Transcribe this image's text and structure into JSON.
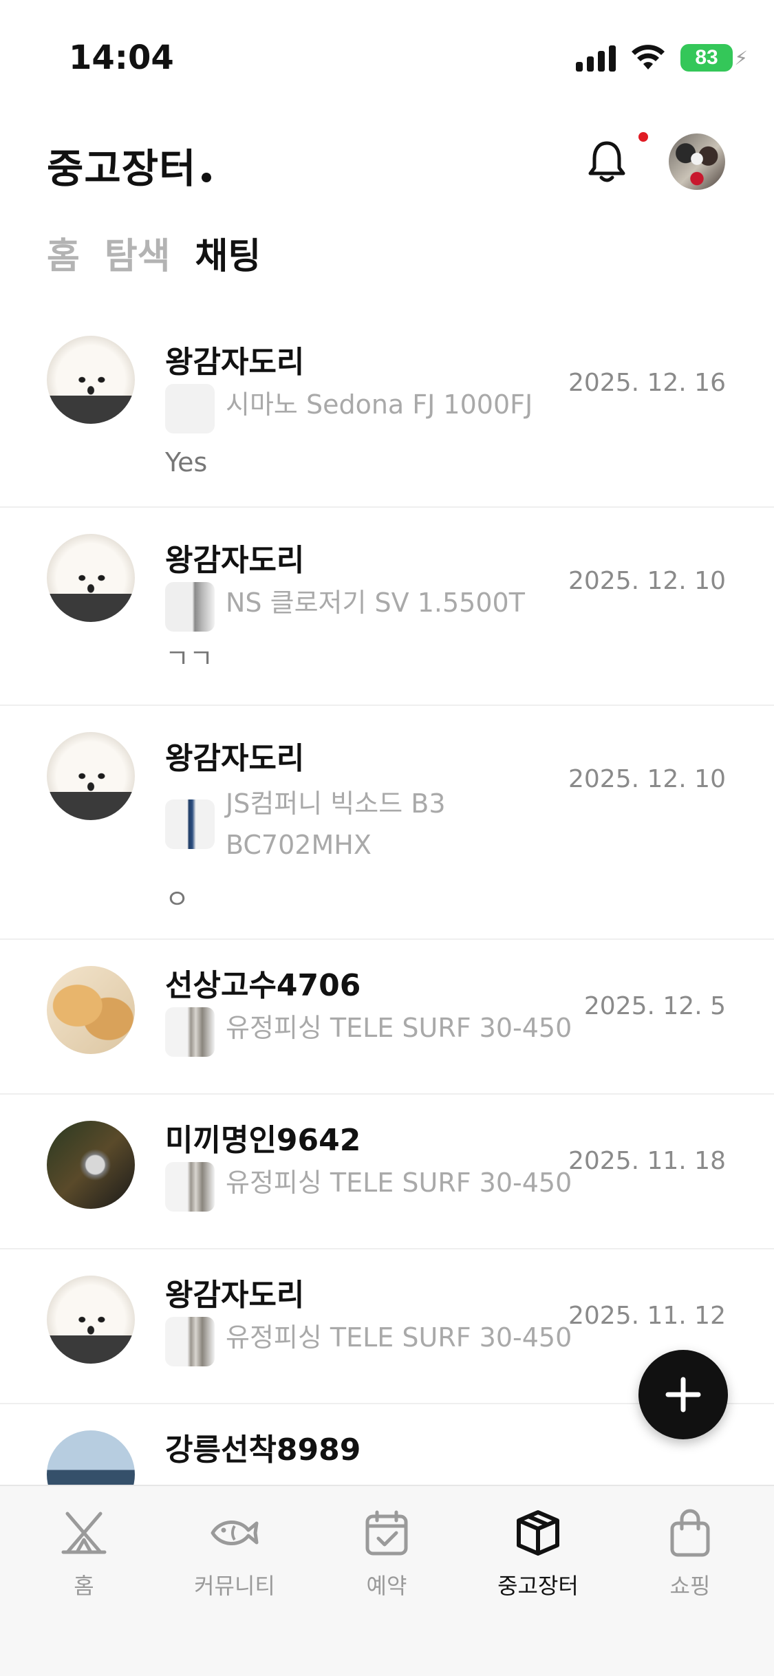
{
  "status_bar": {
    "time": "14:04",
    "battery": "83"
  },
  "header": {
    "title": "중고장터"
  },
  "tabs": [
    {
      "label": "홈",
      "active": false
    },
    {
      "label": "탐색",
      "active": false
    },
    {
      "label": "채팅",
      "active": true
    }
  ],
  "chats": [
    {
      "name": "왕감자도리",
      "product": "시마노 Sedona FJ 1000FJ",
      "message": "Yes",
      "date": "2025. 12. 16",
      "avatar": "pomeranian-avatar"
    },
    {
      "name": "왕감자도리",
      "product": "NS 클로저기 SV 1.5500T",
      "message": "ㄱㄱ",
      "date": "2025. 12. 10",
      "avatar": "pomeranian-avatar"
    },
    {
      "name": "왕감자도리",
      "product": "JS컴퍼니 빅소드 B3 BC702MHX",
      "message": "ㅇ",
      "date": "2025. 12. 10",
      "avatar": "pomeranian-avatar"
    },
    {
      "name": "선상고수4706",
      "product": "유정피싱 TELE SURF 30-450",
      "message": "",
      "date": "2025. 12. 5",
      "avatar": "taiyaki-avatar"
    },
    {
      "name": "미끼명인9642",
      "product": "유정피싱 TELE SURF 30-450",
      "message": "",
      "date": "2025. 11. 18",
      "avatar": "fishing-reel-avatar"
    },
    {
      "name": "왕감자도리",
      "product": "유정피싱 TELE SURF 30-450",
      "message": "",
      "date": "2025. 11. 12",
      "avatar": "pomeranian-avatar"
    },
    {
      "name": "강릉선착8989",
      "product": "",
      "message": "",
      "date": "",
      "avatar": "sea-avatar"
    }
  ],
  "bottom_nav": [
    {
      "label": "홈",
      "icon": "tent-icon",
      "active": false
    },
    {
      "label": "커뮤니티",
      "icon": "fish-icon",
      "active": false
    },
    {
      "label": "예약",
      "icon": "calendar-check-icon",
      "active": false
    },
    {
      "label": "중고장터",
      "icon": "box-icon",
      "active": true
    },
    {
      "label": "쇼핑",
      "icon": "shopping-bag-icon",
      "active": false
    }
  ],
  "colors": {
    "accent": "#111111",
    "notification_dot": "#e01b24",
    "battery": "#34c759",
    "muted_text": "#a9a9a9"
  }
}
